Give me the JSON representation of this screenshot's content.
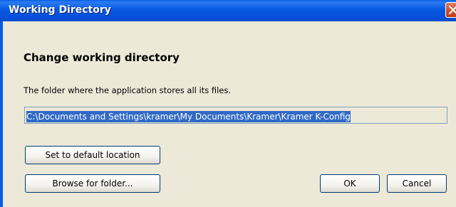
{
  "window": {
    "title": "Working Directory",
    "close_icon": "close-icon"
  },
  "content": {
    "heading": "Change working directory",
    "description": "The folder where the application stores all its files.",
    "path_value": "C:\\Documents and Settings\\kramer\\My Documents\\Kramer\\Kramer K-Config"
  },
  "buttons": {
    "default_location": "Set to default location",
    "browse": "Browse for folder...",
    "ok": "OK",
    "cancel": "Cancel"
  },
  "colors": {
    "titlebar": "#0858e2",
    "selection": "#316ac5",
    "dialog_bg": "#ece9d8"
  }
}
